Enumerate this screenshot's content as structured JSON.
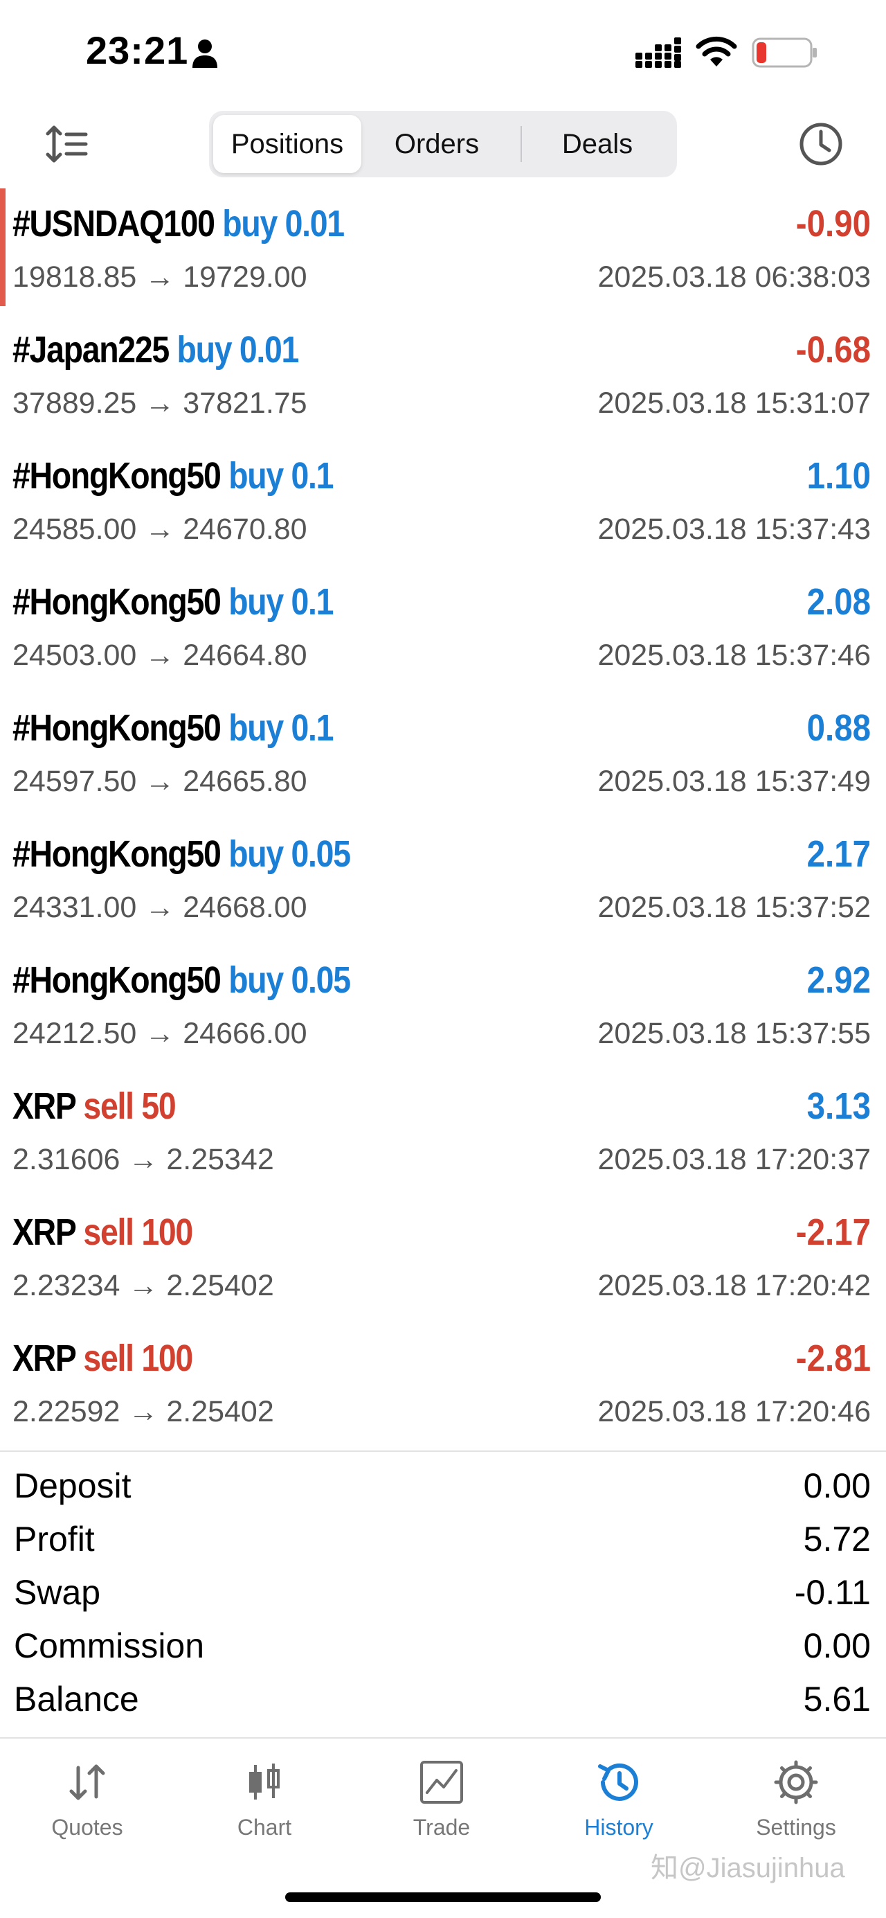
{
  "status_bar": {
    "time": "23:21"
  },
  "toolbar": {
    "tabs": [
      {
        "label": "Positions",
        "active": true
      },
      {
        "label": "Orders",
        "active": false
      },
      {
        "label": "Deals",
        "active": false
      }
    ]
  },
  "deals": [
    {
      "symbol": "#USNDAQ100",
      "side": "buy 0.01",
      "profit": "-0.90",
      "prices": "19818.85 → 19729.00",
      "time": "2025.03.18 06:38:03"
    },
    {
      "symbol": "#Japan225",
      "side": "buy 0.01",
      "profit": "-0.68",
      "prices": "37889.25 → 37821.75",
      "time": "2025.03.18 15:31:07"
    },
    {
      "symbol": "#HongKong50",
      "side": "buy 0.1",
      "profit": "1.10",
      "prices": "24585.00 → 24670.80",
      "time": "2025.03.18 15:37:43"
    },
    {
      "symbol": "#HongKong50",
      "side": "buy 0.1",
      "profit": "2.08",
      "prices": "24503.00 → 24664.80",
      "time": "2025.03.18 15:37:46"
    },
    {
      "symbol": "#HongKong50",
      "side": "buy 0.1",
      "profit": "0.88",
      "prices": "24597.50 → 24665.80",
      "time": "2025.03.18 15:37:49"
    },
    {
      "symbol": "#HongKong50",
      "side": "buy 0.05",
      "profit": "2.17",
      "prices": "24331.00 → 24668.00",
      "time": "2025.03.18 15:37:52"
    },
    {
      "symbol": "#HongKong50",
      "side": "buy 0.05",
      "profit": "2.92",
      "prices": "24212.50 → 24666.00",
      "time": "2025.03.18 15:37:55"
    },
    {
      "symbol": "XRP",
      "side": "sell 50",
      "profit": "3.13",
      "prices": "2.31606 → 2.25342",
      "time": "2025.03.18 17:20:37"
    },
    {
      "symbol": "XRP",
      "side": "sell 100",
      "profit": "-2.17",
      "prices": "2.23234 → 2.25402",
      "time": "2025.03.18 17:20:42"
    },
    {
      "symbol": "XRP",
      "side": "sell 100",
      "profit": "-2.81",
      "prices": "2.22592 → 2.25402",
      "time": "2025.03.18 17:20:46"
    }
  ],
  "summary": [
    {
      "label": "Deposit",
      "value": "0.00"
    },
    {
      "label": "Profit",
      "value": "5.72"
    },
    {
      "label": "Swap",
      "value": "-0.11"
    },
    {
      "label": "Commission",
      "value": "0.00"
    },
    {
      "label": "Balance",
      "value": "5.61"
    }
  ],
  "tab_bar": {
    "tabs": [
      {
        "label": "Quotes",
        "icon": "quotes-arrows-icon",
        "active": false
      },
      {
        "label": "Chart",
        "icon": "candlestick-icon",
        "active": false
      },
      {
        "label": "Trade",
        "icon": "trade-chart-icon",
        "active": false
      },
      {
        "label": "History",
        "icon": "history-clock-icon",
        "active": true
      },
      {
        "label": "Settings",
        "icon": "gear-icon",
        "active": false
      }
    ]
  },
  "watermark": "知@Jiasujinhua",
  "colors": {
    "buy": "#1b7fd6",
    "sell": "#d2402f",
    "accent": "#1b7fd6",
    "highlight_bar": "#e15a4c"
  }
}
